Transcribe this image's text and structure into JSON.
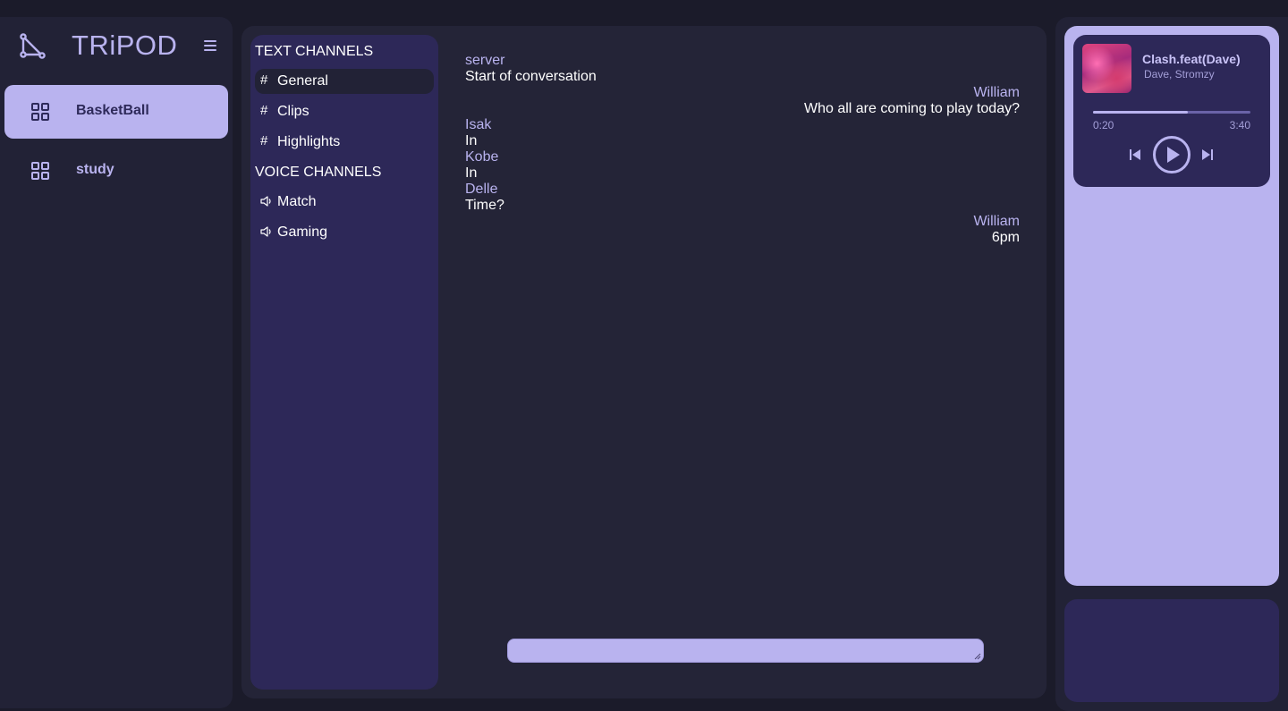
{
  "app": {
    "title": "TRiPOD"
  },
  "icons": {
    "logo": "tripod-logo-icon",
    "menu": "hamburger-menu-icon",
    "server": "grid-icon",
    "text_channel": "hash-icon",
    "voice_channel": "speaker-icon",
    "prev": "skip-previous-icon",
    "play": "play-icon",
    "next": "skip-next-icon"
  },
  "colors": {
    "accent": "#b9b3ef",
    "panel": "#2d2858",
    "background": "#222236"
  },
  "sidebar": {
    "servers": [
      {
        "label": "BasketBall",
        "active": true
      },
      {
        "label": "study",
        "active": false
      }
    ]
  },
  "channels": {
    "text_header": "TEXT CHANNELS",
    "text": [
      {
        "label": "General",
        "active": true
      },
      {
        "label": "Clips",
        "active": false
      },
      {
        "label": "Highlights",
        "active": false
      }
    ],
    "voice_header": "VOICE CHANNELS",
    "voice": [
      {
        "label": "Match"
      },
      {
        "label": "Gaming"
      }
    ]
  },
  "messages": [
    {
      "author": "server",
      "text": "Start of conversation",
      "align": "left"
    },
    {
      "author": "William",
      "text": "Who all are coming to play today?",
      "align": "right"
    },
    {
      "author": "Isak",
      "text": "In",
      "align": "left"
    },
    {
      "author": "Kobe",
      "text": "In",
      "align": "left"
    },
    {
      "author": "Delle",
      "text": "Time?",
      "align": "left"
    },
    {
      "author": "William",
      "text": "6pm",
      "align": "right"
    }
  ],
  "chat_input": {
    "value": ""
  },
  "player": {
    "title": "Clash.feat(Dave)",
    "artist": "Dave, Stromzy",
    "elapsed": "0:20",
    "duration": "3:40",
    "progress": 0.6
  }
}
